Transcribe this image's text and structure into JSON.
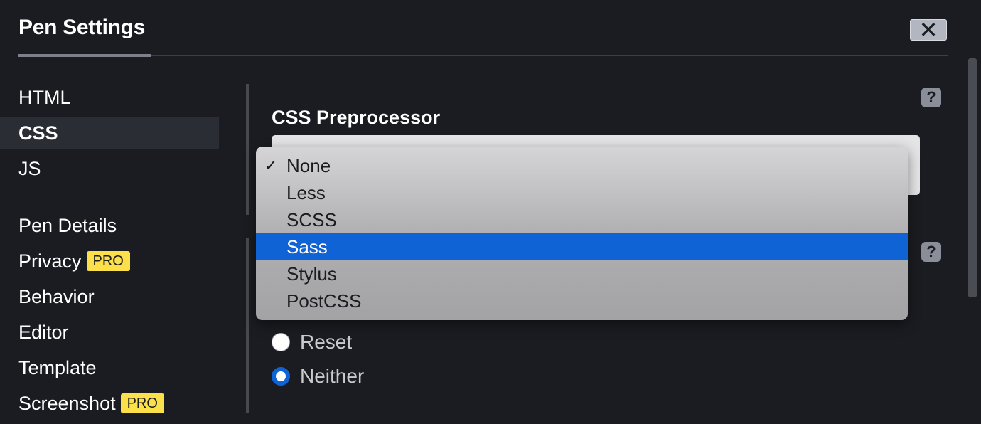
{
  "header": {
    "title": "Pen Settings",
    "close_symbol": "✕"
  },
  "sidebar": {
    "items": [
      {
        "label": "HTML",
        "active": false
      },
      {
        "label": "CSS",
        "active": true
      },
      {
        "label": "JS",
        "active": false
      },
      {
        "label": "Pen Details",
        "active": false
      },
      {
        "label": "Privacy",
        "badge": "PRO"
      },
      {
        "label": "Behavior"
      },
      {
        "label": "Editor"
      },
      {
        "label": "Template"
      },
      {
        "label": "Screenshot",
        "badge": "PRO"
      }
    ]
  },
  "main": {
    "help_symbol": "?",
    "preprocessor_label": "CSS Preprocessor",
    "dropdown": {
      "selected": "None",
      "highlighted": "Sass",
      "checkmark": "✓",
      "options": [
        "None",
        "Less",
        "SCSS",
        "Sass",
        "Stylus",
        "PostCSS"
      ]
    },
    "base_radios": [
      {
        "label": "Reset",
        "checked": false
      },
      {
        "label": "Neither",
        "checked": true
      }
    ]
  },
  "colors": {
    "background": "#1b1c21",
    "accent_blue": "#1063d4",
    "pro_badge": "#fbe04a",
    "active_nav": "#2b2d34"
  },
  "icons": [
    "close-icon",
    "help-icon",
    "checkmark-icon"
  ]
}
